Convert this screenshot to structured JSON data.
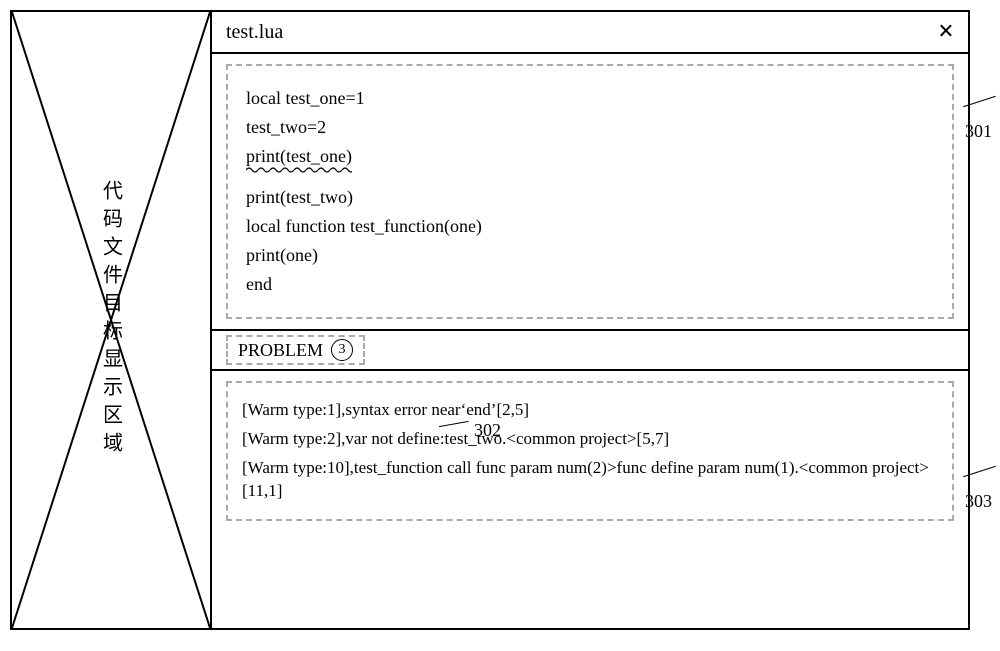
{
  "sidebar": {
    "label": "代码文件目标显示区域"
  },
  "titlebar": {
    "filename": "test.lua"
  },
  "code": {
    "lines": [
      "local test_one=1",
      "test_two=2",
      "print(test_one)",
      "print(test_two)",
      "local function test_function(one)",
      "print(one)",
      "end"
    ],
    "wavy_line_index": 2
  },
  "problem_tab": {
    "label": "PROBLEM",
    "count": "3"
  },
  "problems": [
    "[Warm type:1],syntax error near‘end’[2,5]",
    "[Warm type:2],var not define:test_two.<common project>[5,7]",
    "[Warm type:10],test_function call func param num(2)>func define param num(1).<common project>[11,1]"
  ],
  "callouts": {
    "code": "301",
    "problem_tab": "302",
    "problems": "303"
  }
}
